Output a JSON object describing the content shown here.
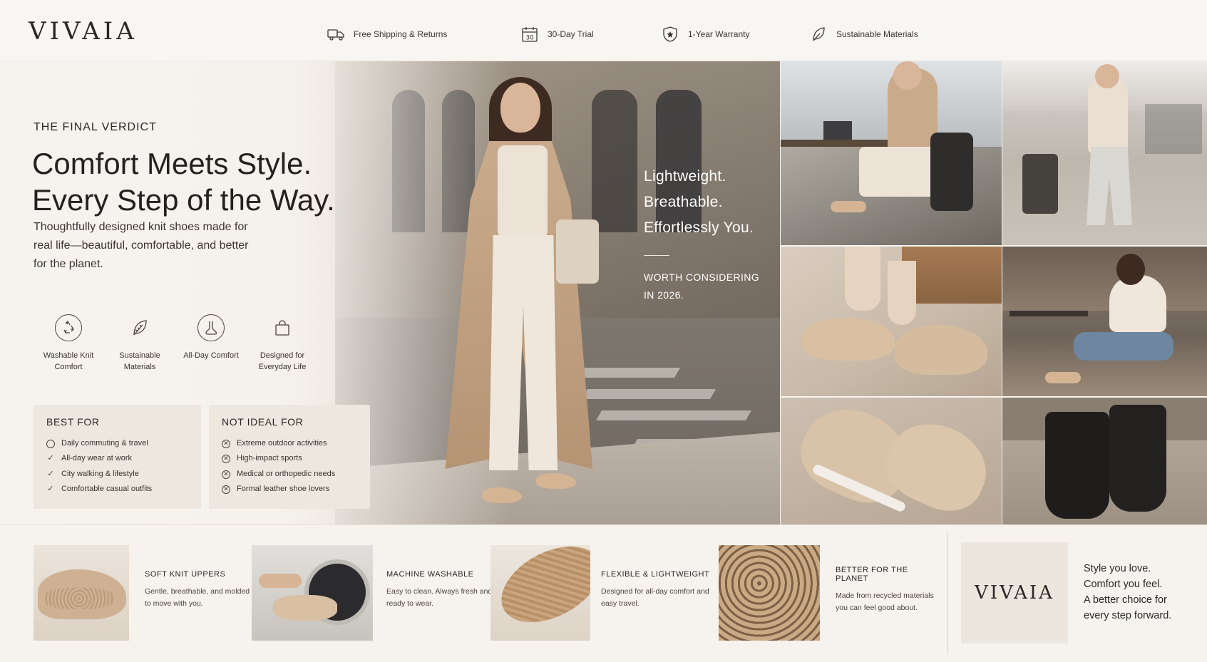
{
  "header": {
    "logo": "VIVAIA",
    "perks": [
      {
        "icon": "truck-icon",
        "label": "Free Shipping & Returns"
      },
      {
        "icon": "calendar-icon",
        "label": "30-Day Trial",
        "calendar_number": "30"
      },
      {
        "icon": "shield-star-icon",
        "label": "1-Year Warranty"
      },
      {
        "icon": "leaf-icon",
        "label": "Sustainable Materials"
      }
    ]
  },
  "hero": {
    "eyebrow": "THE FINAL VERDICT",
    "headline": [
      "Comfort Meets Style.",
      "Every Step of the Way."
    ],
    "intro": "Thoughtfully designed knit shoes made for real life—beautiful, comfortable, and better for the planet.",
    "badges": [
      {
        "icon": "recycle-icon",
        "label": "Washable Knit Comfort"
      },
      {
        "icon": "leaf-icon",
        "label": "Sustainable Materials"
      },
      {
        "icon": "foot-icon",
        "label": "All-Day Comfort"
      },
      {
        "icon": "shopping-bag-icon",
        "label": "Designed for Everyday Life"
      }
    ],
    "quote": [
      "Lightweight.",
      "Breathable.",
      "Effortlessly You."
    ],
    "quote_sub": [
      "WORTH CONSIDERING",
      "IN 2026."
    ]
  },
  "fit": {
    "best": {
      "title": "BEST FOR",
      "items": [
        {
          "icon": "circle",
          "text": "Daily commuting & travel"
        },
        {
          "icon": "check",
          "text": "All-day wear at work"
        },
        {
          "icon": "check",
          "text": "City walking & lifestyle"
        },
        {
          "icon": "check",
          "text": "Comfortable casual outfits"
        }
      ]
    },
    "not": {
      "title": "NOT IDEAL FOR",
      "items": [
        {
          "icon": "x",
          "text": "Extreme outdoor activities"
        },
        {
          "icon": "x",
          "text": "High-impact sports"
        },
        {
          "icon": "x",
          "text": "Medical or orthopedic needs"
        },
        {
          "icon": "x",
          "text": "Formal leather shoe lovers"
        }
      ]
    }
  },
  "features": [
    {
      "title": "SOFT KNIT UPPERS",
      "desc": "Gentle, breathable, and molded to move with you."
    },
    {
      "title": "MACHINE WASHABLE",
      "desc": "Easy to clean. Always fresh and ready to wear."
    },
    {
      "title": "FLEXIBLE & LIGHTWEIGHT",
      "desc": "Designed for all-day comfort and easy travel."
    },
    {
      "title": "BETTER FOR THE PLANET",
      "desc": "Made from recycled materials you can feel good about."
    }
  ],
  "brand_block": {
    "logo": "VIVAIA",
    "tagline": [
      "Style you love.",
      "Comfort you feel.",
      "A better choice for",
      "every step forward."
    ]
  },
  "colors": {
    "background": "#f6f3ef",
    "text": "#2b2724",
    "card": "#ede7e0",
    "accent_tan": "#c9ab8c"
  }
}
